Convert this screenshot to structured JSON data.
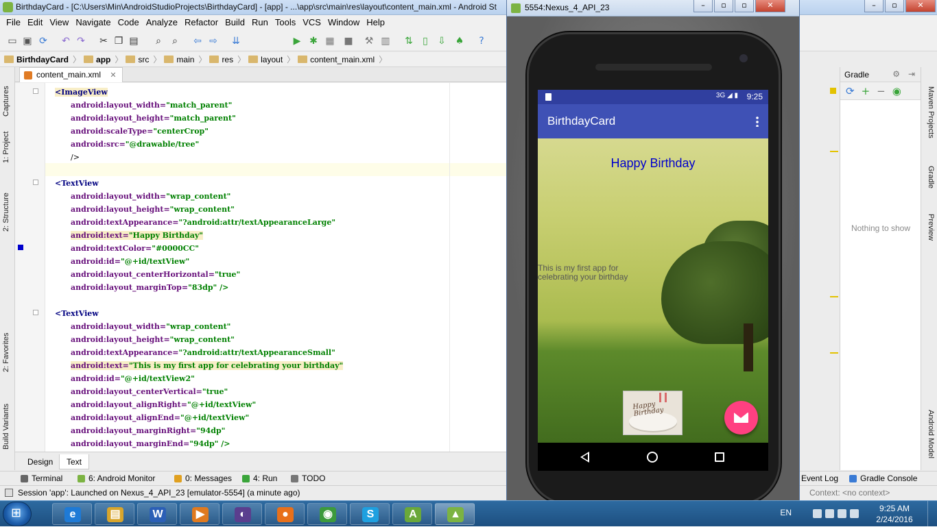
{
  "ide": {
    "window_title": "BirthdayCard - [C:\\Users\\Min\\AndroidStudioProjects\\BirthdayCard] - [app] - ...\\app\\src\\main\\res\\layout\\content_main.xml - Android St",
    "menu": [
      "File",
      "Edit",
      "View",
      "Navigate",
      "Code",
      "Analyze",
      "Refactor",
      "Build",
      "Run",
      "Tools",
      "VCS",
      "Window",
      "Help"
    ],
    "run_config": "app",
    "breadcrumbs": [
      "BirthdayCard",
      "app",
      "src",
      "main",
      "res",
      "layout",
      "content_main.xml"
    ],
    "editor_tab": "content_main.xml",
    "left_tools": [
      "Captures",
      "1: Project",
      "2: Structure",
      "2: Favorites",
      "Build Variants"
    ],
    "right_tools": [
      "Maven Projects",
      "Gradle",
      "Preview",
      "Android Model"
    ],
    "design_tabs": [
      "Design",
      "Text"
    ],
    "bottom_tools": [
      "Terminal",
      "6: Android Monitor",
      "0: Messages",
      "4: Run",
      "TODO",
      "Event Log",
      "Gradle Console"
    ],
    "status_message": "Session 'app': Launched on Nexus_4_API_23 [emulator-5554] (a minute ago)",
    "status_context": "Context: <no context>",
    "gradle_panel": {
      "title": "Gradle",
      "empty_text": "Nothing to show"
    }
  },
  "code": [
    {
      "indent": 0,
      "tag": "<ImageView"
    },
    {
      "indent": 1,
      "attr": "android:layout_width=",
      "val": "\"match_parent\""
    },
    {
      "indent": 1,
      "attr": "android:layout_height=",
      "val": "\"match_parent\""
    },
    {
      "indent": 1,
      "attr": "android:scaleType=",
      "val": "\"centerCrop\""
    },
    {
      "indent": 1,
      "attr": "android:src=",
      "val": "\"@drawable/tree\""
    },
    {
      "indent": 1,
      "plain": "/>"
    },
    {
      "indent": 0,
      "plain": ""
    },
    {
      "indent": 0,
      "tag": "<TextView"
    },
    {
      "indent": 1,
      "attr": "android:layout_width=",
      "val": "\"wrap_content\""
    },
    {
      "indent": 1,
      "attr": "android:layout_height=",
      "val": "\"wrap_content\""
    },
    {
      "indent": 1,
      "attr": "android:textAppearance=",
      "val": "\"?android:attr/textAppearanceLarge\""
    },
    {
      "indent": 1,
      "attr": "android:text=",
      "val": "\"Happy Birthday\""
    },
    {
      "indent": 1,
      "attr": "android:textColor=",
      "val": "\"#0000CC\""
    },
    {
      "indent": 1,
      "attr": "android:id=",
      "val": "\"@+id/textView\""
    },
    {
      "indent": 1,
      "attr": "android:layout_centerHorizontal=",
      "val": "\"true\""
    },
    {
      "indent": 1,
      "attr": "android:layout_marginTop=",
      "val": "\"83dp\" />"
    },
    {
      "indent": 0,
      "plain": ""
    },
    {
      "indent": 0,
      "tag": "<TextView"
    },
    {
      "indent": 1,
      "attr": "android:layout_width=",
      "val": "\"wrap_content\""
    },
    {
      "indent": 1,
      "attr": "android:layout_height=",
      "val": "\"wrap_content\""
    },
    {
      "indent": 1,
      "attr": "android:textAppearance=",
      "val": "\"?android:attr/textAppearanceSmall\""
    },
    {
      "indent": 1,
      "attr": "android:text=",
      "val": "\"This is my first app for celebrating your birthday\""
    },
    {
      "indent": 1,
      "attr": "android:id=",
      "val": "\"@+id/textView2\""
    },
    {
      "indent": 1,
      "attr": "android:layout_centerVertical=",
      "val": "\"true\""
    },
    {
      "indent": 1,
      "attr": "android:layout_alignRight=",
      "val": "\"@+id/textView\""
    },
    {
      "indent": 1,
      "attr": "android:layout_alignEnd=",
      "val": "\"@+id/textView\""
    },
    {
      "indent": 1,
      "attr": "android:layout_marginRight=",
      "val": "\"94dp\""
    },
    {
      "indent": 1,
      "attr": "android:layout_marginEnd=",
      "val": "\"94dp\" />"
    }
  ],
  "emulator": {
    "window_title": "5554:Nexus_4_API_23",
    "status_time": "9:25",
    "status_signal": "3G",
    "app_title": "BirthdayCard",
    "happy_text": "Happy Birthday",
    "first_app_text": "This is my first app for celebrating your birthday",
    "cake_text": "Happy Birthday",
    "fab_color": "#ff4081",
    "happy_color": "#0000cc",
    "toolbar_color": "#3f51b5"
  },
  "taskbar": {
    "apps": [
      "internet-explorer",
      "windows-explorer",
      "word",
      "media-player",
      "eclipse",
      "firefox",
      "chrome",
      "skype",
      "android-studio",
      "android-emulator"
    ],
    "app_glyphs": [
      "e",
      "▤",
      "W",
      "▶",
      "◐",
      "●",
      "◉",
      "S",
      "A",
      "▲"
    ],
    "language": "EN",
    "time": "9:25 AM",
    "date": "2/24/2016"
  }
}
